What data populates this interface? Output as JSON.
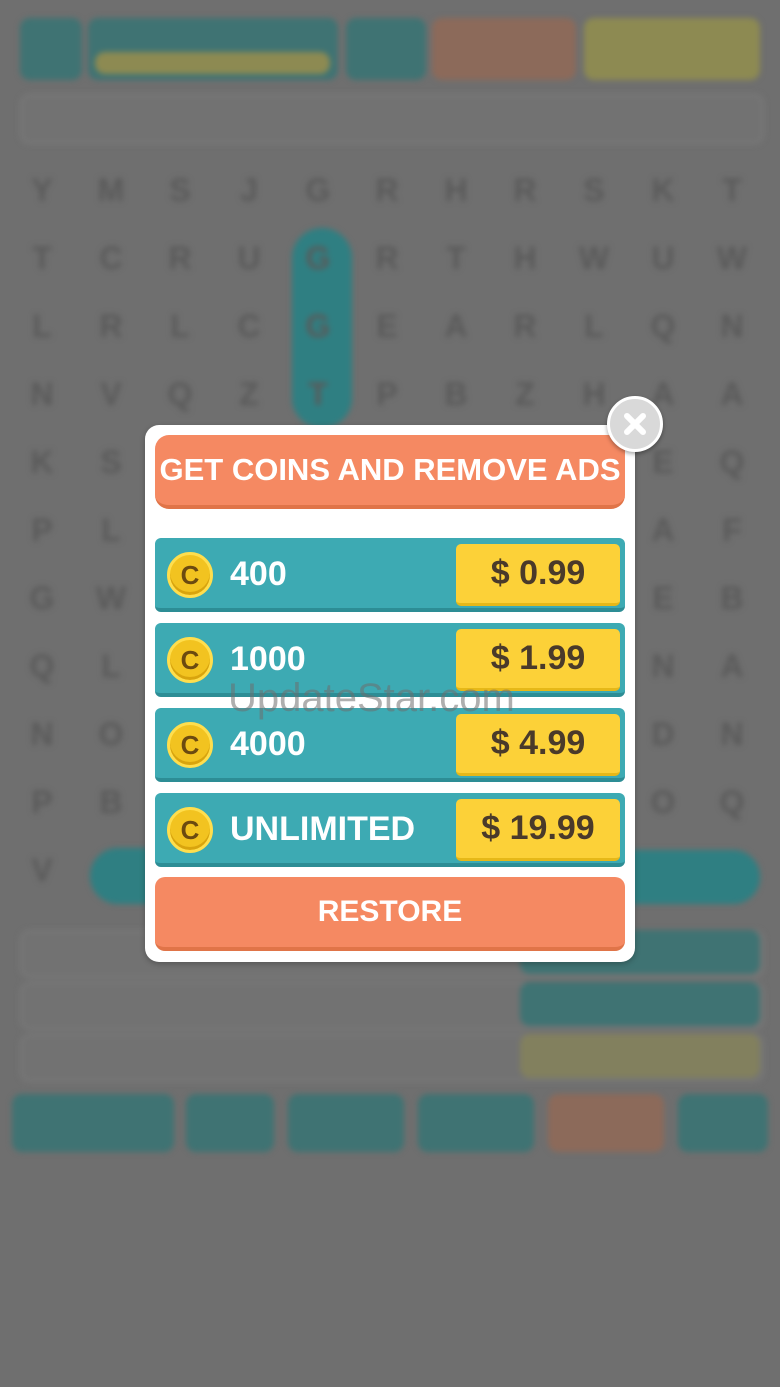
{
  "dialog": {
    "title": "GET COINS AND REMOVE ADS",
    "offers": [
      {
        "amount": "400",
        "price": "$ 0.99",
        "coin_symbol": "C"
      },
      {
        "amount": "1000",
        "price": "$ 1.99",
        "coin_symbol": "C"
      },
      {
        "amount": "4000",
        "price": "$ 4.99",
        "coin_symbol": "C"
      },
      {
        "amount": "UNLIMITED",
        "price": "$ 19.99",
        "coin_symbol": "C"
      }
    ],
    "restore_label": "RESTORE",
    "close_icon": "close-icon"
  },
  "watermark": "UpdateStar.com",
  "background_grid": {
    "rows": [
      "YMSJGRHRSKT",
      "TCRUGRTHWUW",
      "LRLCGEARLQN",
      "NVQZTPBZHAA",
      "KSSMVEPTWEQ",
      "PLRNESAJMAF",
      "GWMRLATSVEB",
      "QLVBARNRLNA",
      "NOFLMOASLDN",
      "PBTOHCJEQOQ",
      "VOTRRLLPSKH"
    ]
  },
  "colors": {
    "accent_orange": "#f58962",
    "accent_teal": "#3daab3",
    "price_yellow": "#fcd138",
    "coin_gold": "#f2c320",
    "overlay_gray": "#6f6f6f"
  }
}
